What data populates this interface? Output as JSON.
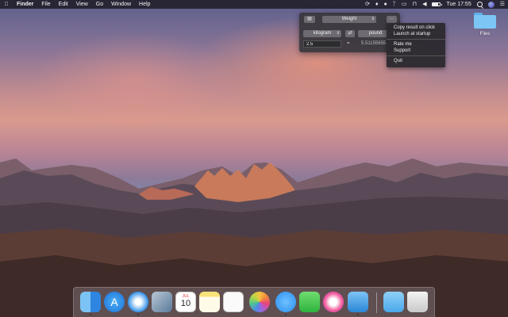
{
  "menubar": {
    "app_name": "Finder",
    "items": [
      "File",
      "Edit",
      "View",
      "Go",
      "Window",
      "Help"
    ],
    "clock": "Tue 17:55",
    "battery_level": 0.75
  },
  "desktop": {
    "folder_label": "Files"
  },
  "converter": {
    "category": "Weight",
    "more_label": "···",
    "from_unit": "kilogram",
    "to_unit": "pound",
    "input_value": "2.5",
    "equals": "=",
    "result": "5.51155655"
  },
  "menu": {
    "items": [
      "Copy result on click",
      "Launch at startup",
      "Rate me",
      "Support",
      "Quit"
    ]
  },
  "dock": {
    "apps": [
      "Finder",
      "App Store",
      "Safari",
      "Preview",
      "Calendar",
      "Notes",
      "Reminders",
      "Photos",
      "Messages",
      "FaceTime",
      "iTunes",
      "Converter",
      "Downloads",
      "Trash"
    ],
    "calendar_month": "JUL",
    "calendar_day": "10"
  },
  "colors": {
    "menubar": "#1e1c26",
    "popover": "#3a383e",
    "menu": "#2c2a30",
    "folder": "#7cc6f5"
  }
}
